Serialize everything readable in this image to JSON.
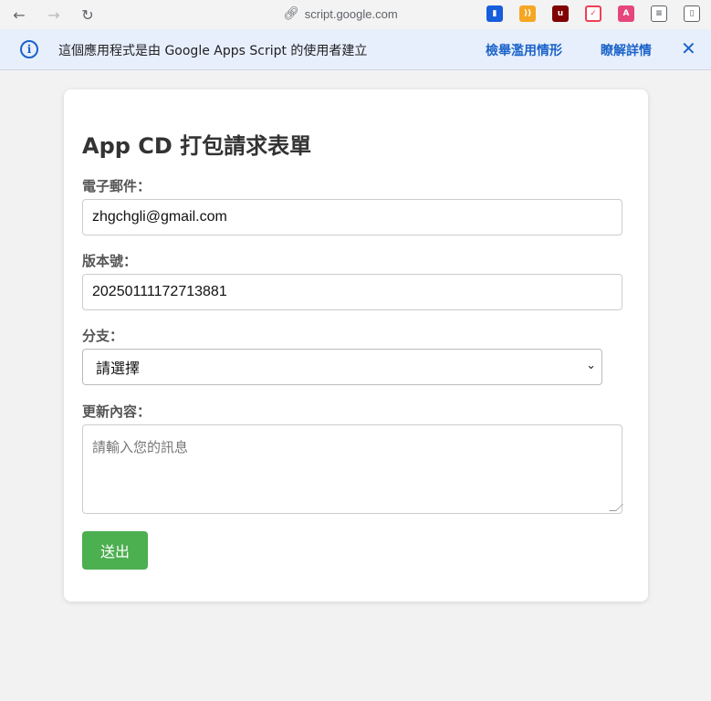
{
  "browser": {
    "url": "script.google.com",
    "extensions": [
      "bitwarden-icon",
      "rss-icon",
      "ublock-icon",
      "pocket-icon",
      "translate-icon",
      "settings-sliders-icon",
      "sidebar-icon"
    ]
  },
  "infobar": {
    "message": "這個應用程式是由 Google Apps Script 的使用者建立",
    "report_link": "檢舉濫用情形",
    "learn_more_link": "瞭解詳情",
    "close_icon": "close-icon"
  },
  "form": {
    "title": "App CD 打包請求表單",
    "email_label": "電子郵件：",
    "email_value": "zhgchgli@gmail.com",
    "version_label": "版本號：",
    "version_value": "20250111172713881",
    "branch_label": "分支：",
    "branch_selected": "請選擇",
    "content_label": "更新內容：",
    "content_placeholder": "請輸入您的訊息",
    "submit_label": "送出"
  },
  "colors": {
    "accent": "#1a63c9",
    "submit": "#4caf50"
  }
}
